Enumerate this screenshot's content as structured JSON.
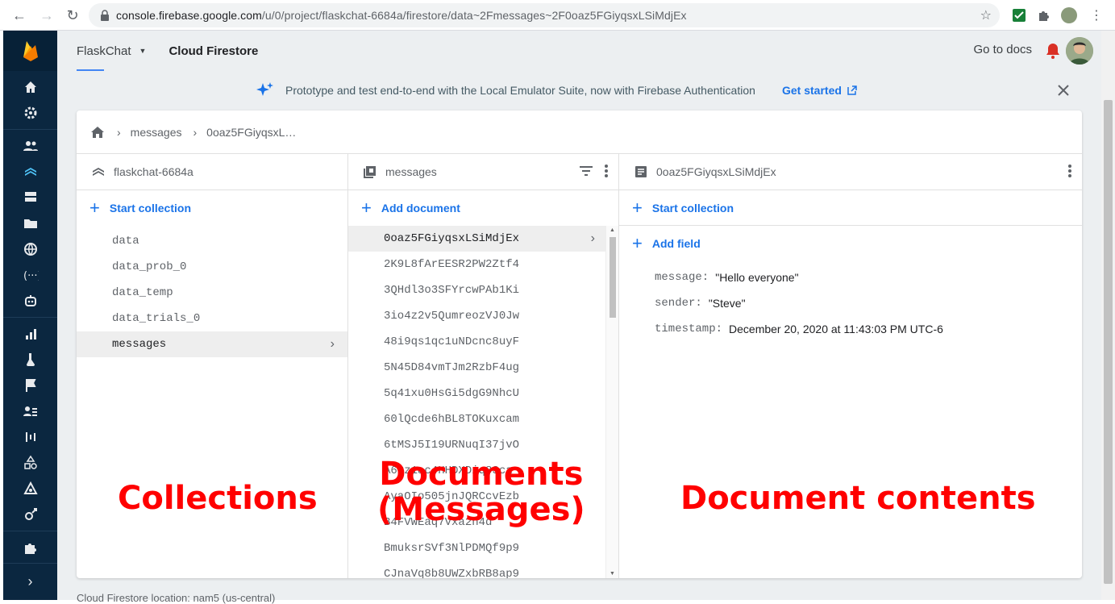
{
  "browser": {
    "url_host": "console.firebase.google.com",
    "url_path": "/u/0/project/flaskchat-6684a/firestore/data~2Fmessages~2F0oaz5FGiyqsxLSiMdjEx"
  },
  "topbar": {
    "project": "FlaskChat",
    "page": "Cloud Firestore",
    "docs_link": "Go to docs"
  },
  "banner": {
    "message": "Prototype and test end-to-end with the Local Emulator Suite, now with Firebase Authentication",
    "cta": "Get started"
  },
  "breadcrumb": {
    "items": [
      "messages",
      "0oaz5FGiyqsxL…"
    ]
  },
  "collections_panel": {
    "title": "flaskchat-6684a",
    "add_label": "Start collection",
    "items": [
      "data",
      "data_prob_0",
      "data_temp",
      "data_trials_0",
      "messages"
    ],
    "selected": "messages"
  },
  "documents_panel": {
    "title": "messages",
    "add_label": "Add document",
    "items": [
      "0oaz5FGiyqsxLSiMdjEx",
      "2K9L8fArEESR2PW2Ztf4",
      "3QHdl3o3SFYrcwPAb1Ki",
      "3io4z2v5QumreozVJ0Jw",
      "48i9qs1qc1uNDcnc8uyF",
      "5N45D84vmTJm2RzbF4ug",
      "5q41xu0HsGi5dgG9NhcU",
      "60lQcde6hBL8TOKuxcam",
      "6tMSJ5I19URNuqI37jvO",
      "A6Cz1ac4HHDXDiq83ca",
      "AyaOIo505jnJQRCcvEzb",
      "B4FVWEaq7Vxa2n4d",
      "BmuksrSVf3NlPDMQf9p9",
      "CJnaVq8b8UWZxbRB8ap9"
    ]
  },
  "document_panel": {
    "title": "0oaz5FGiyqsxLSiMdjEx",
    "add_collection_label": "Start collection",
    "add_field_label": "Add field",
    "fields": [
      {
        "key": "message:",
        "value": "\"Hello everyone\""
      },
      {
        "key": "sender:",
        "value": "\"Steve\""
      },
      {
        "key": "timestamp:",
        "value": "December 20, 2020 at 11:43:03 PM UTC-6"
      }
    ]
  },
  "footer": {
    "location": "Cloud Firestore location: nam5 (us-central)"
  },
  "annotations": {
    "collections": "Collections",
    "documents_line1": "Documents",
    "documents_line2": "(Messages)",
    "contents": "Document contents"
  },
  "colors": {
    "rail": "#0b2740",
    "accent": "#1a73e8",
    "annotation": "#ff0000"
  }
}
